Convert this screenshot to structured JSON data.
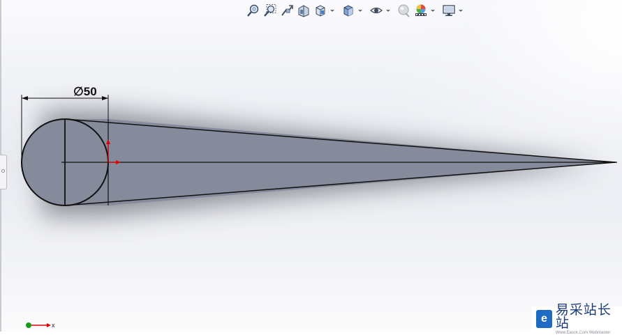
{
  "toolbar": {
    "items": [
      {
        "name": "zoom-to-fit-icon"
      },
      {
        "name": "zoom-to-area-icon"
      },
      {
        "name": "previous-view-icon"
      },
      {
        "name": "section-view-icon"
      },
      {
        "name": "view-orientation-icon",
        "dropdown": true
      },
      {
        "name": "display-style-icon",
        "dropdown": true
      },
      {
        "name": "hide-show-items-icon",
        "dropdown": true
      },
      {
        "name": "edit-appearance-icon"
      },
      {
        "name": "apply-scene-icon",
        "dropdown": true
      },
      {
        "name": "view-settings-icon",
        "dropdown": true
      }
    ]
  },
  "sketch": {
    "dimension_label": "∅50"
  },
  "colors": {
    "fill": "#868b9b",
    "outline": "#111111",
    "axis_red": "#e00000",
    "triad_green": "#1a9a1a"
  },
  "triad": {
    "x_label": "x"
  },
  "watermark": {
    "title": "易采站长站",
    "url": "Www.Easck.Com Webmaster"
  }
}
